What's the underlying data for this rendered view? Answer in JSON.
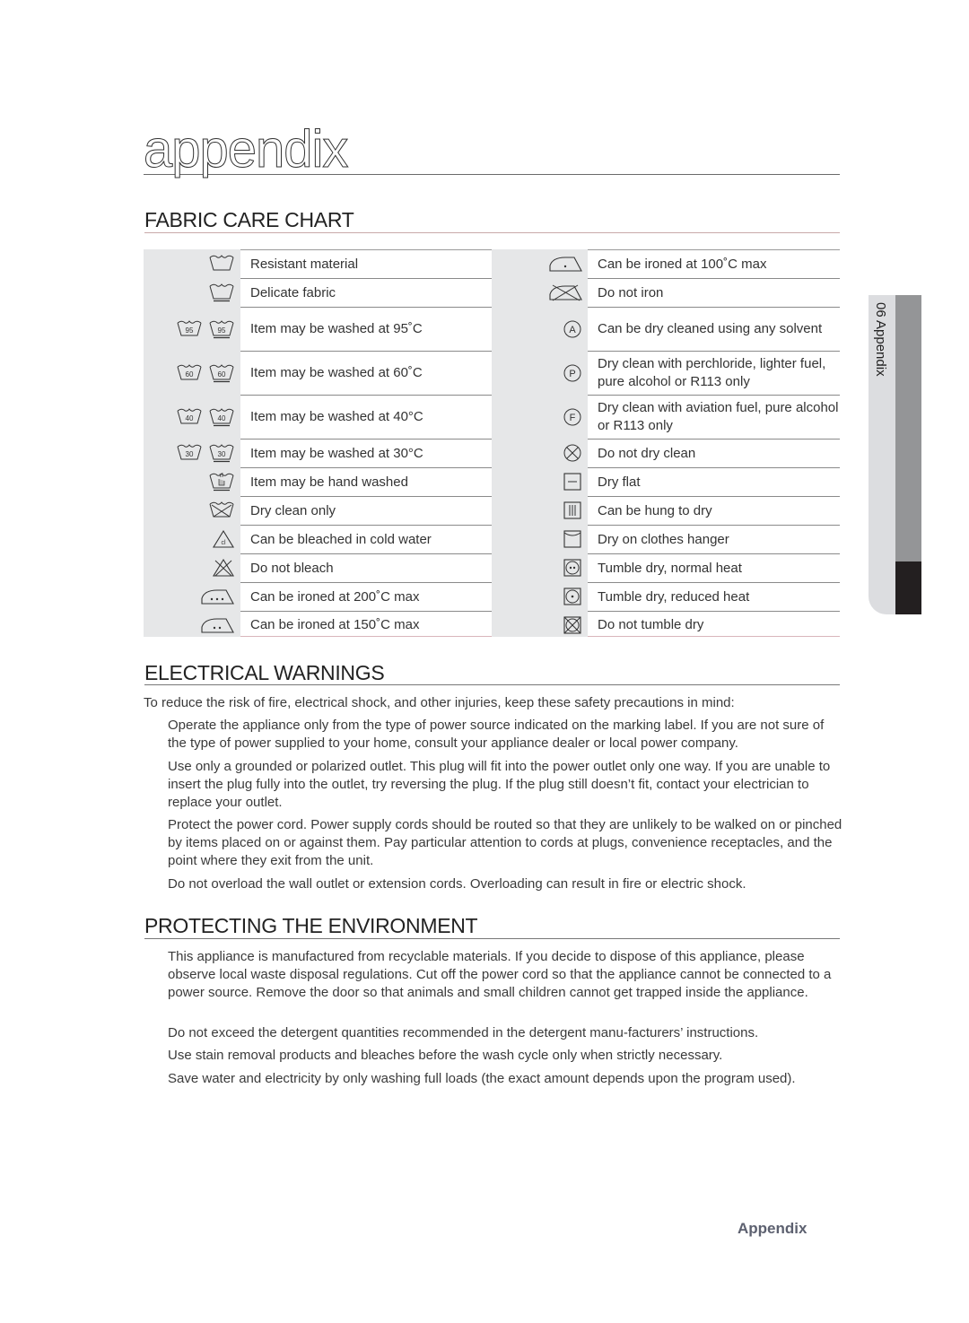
{
  "page": {
    "title": "appendix",
    "footer_label": "Appendix",
    "side_tab_label": "06 Appendix"
  },
  "colors": {
    "icon_column_bg": "#e6e7e8",
    "side_tab_light": "#dcdde0",
    "side_tab_mid": "#949597",
    "side_tab_dark": "#231f20",
    "footer_text": "#5d6170"
  },
  "fabric_care": {
    "heading": "FABRIC CARE CHART",
    "left": [
      {
        "icons": [
          "wash-tub-icon"
        ],
        "label": "Resistant material"
      },
      {
        "icons": [
          "wash-tub-delicate-icon"
        ],
        "label": "Delicate fabric"
      },
      {
        "icons": [
          "wash-95-icon",
          "wash-95-delicate-icon"
        ],
        "label": "Item may be washed at 95˚C",
        "nums": [
          "95",
          "95"
        ]
      },
      {
        "icons": [
          "wash-60-icon",
          "wash-60-delicate-icon"
        ],
        "label": "Item may be washed at 60˚C",
        "nums": [
          "60",
          "60"
        ]
      },
      {
        "icons": [
          "wash-40-icon",
          "wash-40-delicate-icon"
        ],
        "label": "Item may be washed at 40°C",
        "nums": [
          "40",
          "40"
        ]
      },
      {
        "icons": [
          "wash-30-icon",
          "wash-30-delicate-icon"
        ],
        "label": "Item may be washed at 30°C",
        "nums": [
          "30",
          "30"
        ]
      },
      {
        "icons": [
          "hand-wash-icon"
        ],
        "label": "Item may be hand washed"
      },
      {
        "icons": [
          "dry-clean-only-icon"
        ],
        "label": "Dry clean only"
      },
      {
        "icons": [
          "bleach-cold-icon"
        ],
        "label": "Can be bleached in cold water"
      },
      {
        "icons": [
          "do-not-bleach-icon"
        ],
        "label": "Do not bleach"
      },
      {
        "icons": [
          "iron-200-icon"
        ],
        "label": "Can be ironed at 200˚C max"
      },
      {
        "icons": [
          "iron-150-icon"
        ],
        "label": "Can be ironed at 150˚C max"
      }
    ],
    "right": [
      {
        "icons": [
          "iron-100-icon"
        ],
        "label": "Can be ironed at 100˚C max"
      },
      {
        "icons": [
          "do-not-iron-icon"
        ],
        "label": "Do not iron"
      },
      {
        "icons": [
          "dry-clean-a-icon"
        ],
        "label": "Can be dry cleaned using any solvent",
        "letter": "A"
      },
      {
        "icons": [
          "dry-clean-p-icon"
        ],
        "label": "Dry clean with perchloride, lighter fuel, pure alcohol or R113 only",
        "letter": "P"
      },
      {
        "icons": [
          "dry-clean-f-icon"
        ],
        "label": "Dry clean with aviation fuel, pure alcohol or R113 only",
        "letter": "F"
      },
      {
        "icons": [
          "do-not-dry-clean-icon"
        ],
        "label": "Do not dry clean"
      },
      {
        "icons": [
          "dry-flat-icon"
        ],
        "label": "Dry flat"
      },
      {
        "icons": [
          "hang-dry-icon"
        ],
        "label": "Can be hung to dry"
      },
      {
        "icons": [
          "dry-on-hanger-icon"
        ],
        "label": "Dry on clothes hanger"
      },
      {
        "icons": [
          "tumble-dry-normal-icon"
        ],
        "label": "Tumble dry, normal heat"
      },
      {
        "icons": [
          "tumble-dry-reduced-icon"
        ],
        "label": "Tumble dry, reduced heat"
      },
      {
        "icons": [
          "do-not-tumble-dry-icon"
        ],
        "label": "Do not tumble dry"
      }
    ]
  },
  "electrical": {
    "heading": "ELECTRICAL WARNINGS",
    "intro": "To reduce the risk of fire, electrical shock, and other injuries, keep these safety precautions in mind:",
    "items": [
      "Operate the appliance only from the type of power source indicated on the marking label. If you are not sure of the type of power supplied to your home, consult your appliance dealer or local power company.",
      "Use only a grounded or polarized outlet. This plug will fit into the power outlet only one way. If you are unable to insert the plug fully into the outlet, try reversing the plug. If the plug still doesn’t fit, contact your electrician to replace your outlet.",
      "Protect the power cord. Power supply cords should be routed so that they are unlikely to be walked on or pinched by items placed on or against them. Pay particular attention to cords at plugs, convenience receptacles, and the point where they exit from the unit.",
      "Do not overload the wall outlet or extension cords. Overloading can result in fire or electric shock."
    ]
  },
  "environment": {
    "heading": "PROTECTING THE ENVIRONMENT",
    "items": [
      "This appliance is manufactured from recyclable materials. If you decide to dispose of this appliance, please observe local waste disposal regulations. Cut off the power cord so that the appliance cannot be connected to a power source. Remove the door so that animals and small children cannot get trapped inside the appliance.",
      "Do not exceed the detergent quantities recommended in the detergent manu-facturers’ instructions.",
      "Use stain removal products and bleaches before the wash cycle only when strictly necessary.",
      "Save water and electricity by only washing full loads (the exact amount depends upon the program used)."
    ]
  }
}
